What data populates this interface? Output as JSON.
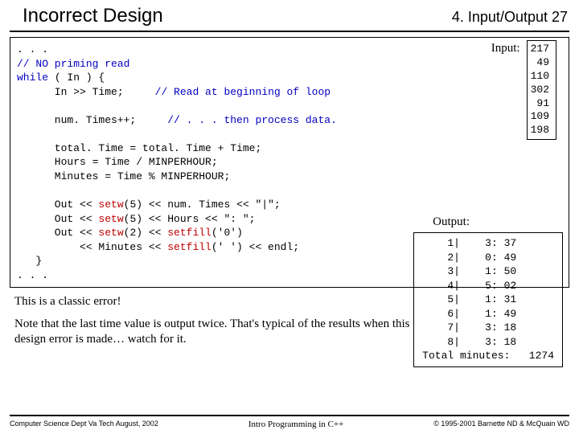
{
  "header": {
    "title": "Incorrect Design",
    "chapter": "4. Input/Output  27"
  },
  "code": {
    "l1": ". . .",
    "l2a": "// NO priming read",
    "l3a": "while",
    "l3b": " ( In ) {",
    "l4a": "      In >> Time;     ",
    "l4b": "// Read at beginning of loop",
    "l5": "",
    "l6a": "      num. Times++;     ",
    "l6b": "// . . . then process data.",
    "l7": "",
    "l8": "      total. Time = total. Time + Time;",
    "l9": "      Hours = Time / MINPERHOUR;",
    "l10": "      Minutes = Time % MINPERHOUR;",
    "l11": "",
    "l12a": "      Out << ",
    "l12b": "setw",
    "l12c": "(5) << num. Times << \"|\";",
    "l13a": "      Out << ",
    "l13b": "setw",
    "l13c": "(5) << Hours << \": \";",
    "l14a": "      Out << ",
    "l14b": "setw",
    "l14c": "(2) << ",
    "l14d": "setfill",
    "l14e": "('0')",
    "l15a": "          << Minutes << ",
    "l15b": "setfill",
    "l15c": "(' ') << endl;",
    "l16": "   }",
    "l17": ". . ."
  },
  "input": {
    "label": "Input:",
    "values": "217\n49\n110\n302\n91\n109\n198"
  },
  "output": {
    "label": "Output:",
    "values": "    1|    3: 37\n    2|    0: 49\n    3|    1: 50\n    4|    5: 02\n    5|    1: 31\n    6|    1: 49\n    7|    3: 18\n    8|    3: 18\nTotal minutes:   1274"
  },
  "notes": {
    "p1": "This is a classic error!",
    "p2": "Note that the last time value is output twice.  That's typical of the results when this design error is made… watch for it."
  },
  "footer": {
    "left": "Computer Science Dept Va Tech  August, 2002",
    "center": "Intro Programming in C++",
    "right": "© 1995-2001  Barnette ND & McQuain WD"
  }
}
